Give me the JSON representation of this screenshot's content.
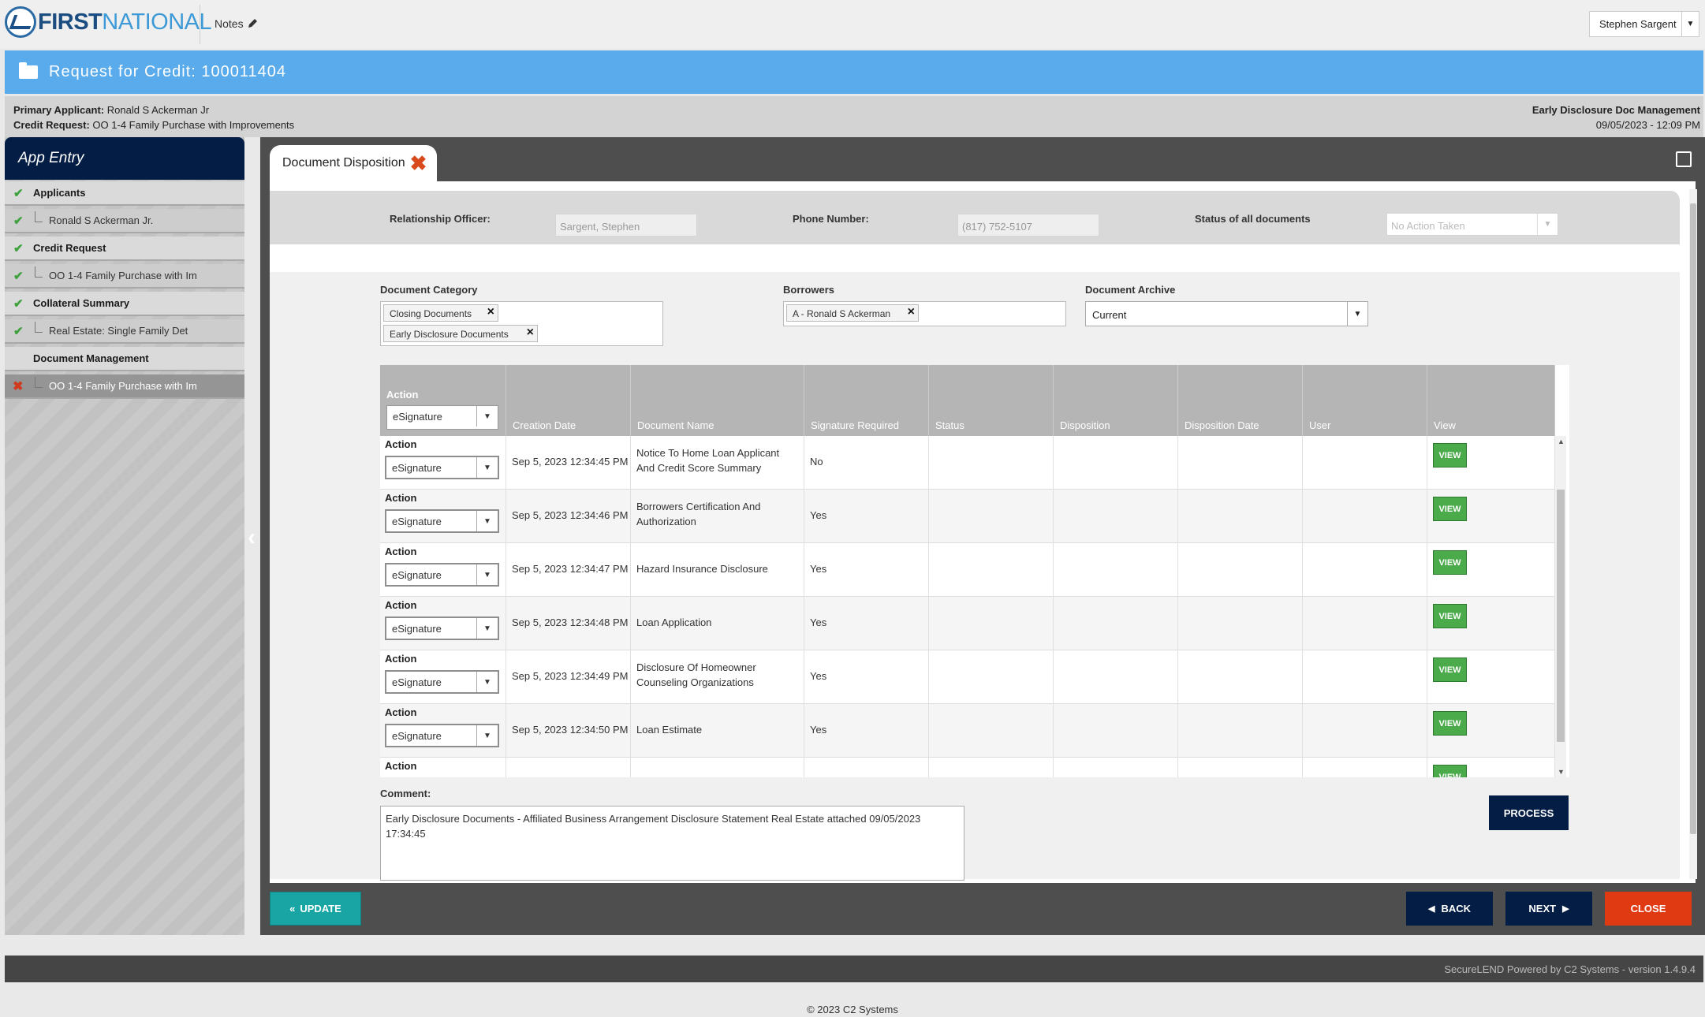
{
  "header": {
    "logo_first": "FIRST",
    "logo_second": "NATIONAL",
    "notes_label": "Notes",
    "user_name": "Stephen Sargent"
  },
  "title": "Request for Credit: 100011404",
  "info": {
    "primary_applicant_label": "Primary Applicant:",
    "primary_applicant": "Ronald S Ackerman Jr",
    "credit_request_label": "Credit Request:",
    "credit_request": "OO 1-4 Family Purchase with Improvements",
    "module": "Early Disclosure Doc Management",
    "datetime": "09/05/2023 - 12:09 PM"
  },
  "sidebar": {
    "title": "App Entry",
    "items": [
      {
        "label": "Applicants",
        "type": "header",
        "status": "done"
      },
      {
        "label": "Ronald S Ackerman Jr.",
        "type": "sub",
        "status": "done"
      },
      {
        "label": "Credit Request",
        "type": "header",
        "status": "done"
      },
      {
        "label": "OO 1-4 Family Purchase with Im",
        "type": "sub",
        "status": "done"
      },
      {
        "label": "Collateral Summary",
        "type": "header",
        "status": "done"
      },
      {
        "label": "Real Estate: Single Family Det",
        "type": "sub",
        "status": "done"
      },
      {
        "label": "Document Management",
        "type": "header",
        "status": "none"
      },
      {
        "label": "OO 1-4 Family Purchase with Im",
        "type": "sub",
        "status": "error",
        "active": true
      }
    ]
  },
  "tab": {
    "label": "Document Disposition"
  },
  "officer": {
    "relationship_officer_label": "Relationship Officer:",
    "relationship_officer": "Sargent, Stephen",
    "phone_label": "Phone Number:",
    "phone": "(817) 752-5107",
    "status_label": "Status of all documents",
    "status_value": "No Action Taken"
  },
  "filters": {
    "category_label": "Document Category",
    "categories": [
      "Closing Documents",
      "Early Disclosure Documents"
    ],
    "borrowers_label": "Borrowers",
    "borrowers": [
      "A - Ronald S Ackerman"
    ],
    "archive_label": "Document Archive",
    "archive_value": "Current"
  },
  "grid": {
    "header_action_label": "Action",
    "header_action_value": "eSignature",
    "columns": [
      "Creation Date",
      "Document Name",
      "Signature Required",
      "Status",
      "Disposition",
      "Disposition Date",
      "User",
      "View"
    ],
    "action_label": "Action",
    "view_label": "VIEW",
    "rows": [
      {
        "action": "eSignature",
        "created": "Sep 5, 2023 12:34:45 PM",
        "name_1": "Notice To Home Loan Applicant",
        "name_2": "And Credit Score Summary",
        "sig": "No"
      },
      {
        "action": "eSignature",
        "created": "Sep 5, 2023 12:34:46 PM",
        "name_1": "Borrowers Certification And",
        "name_2": "Authorization",
        "sig": "Yes"
      },
      {
        "action": "eSignature",
        "created": "Sep 5, 2023 12:34:47 PM",
        "name_1": "Hazard Insurance Disclosure",
        "name_2": "",
        "sig": "Yes"
      },
      {
        "action": "eSignature",
        "created": "Sep 5, 2023 12:34:48 PM",
        "name_1": "Loan Application",
        "name_2": "",
        "sig": "Yes"
      },
      {
        "action": "eSignature",
        "created": "Sep 5, 2023 12:34:49 PM",
        "name_1": "Disclosure Of Homeowner",
        "name_2": "Counseling Organizations",
        "sig": "Yes"
      },
      {
        "action": "eSignature",
        "created": "Sep 5, 2023 12:34:50 PM",
        "name_1": "Loan Estimate",
        "name_2": "",
        "sig": "Yes"
      }
    ]
  },
  "comment": {
    "label": "Comment:",
    "text": "Early Disclosure Documents - Affiliated Business Arrangement Disclosure Statement Real Estate attached 09/05/2023 17:34:45"
  },
  "buttons": {
    "process": "PROCESS",
    "update": "UPDATE",
    "back": "BACK",
    "next": "NEXT",
    "close": "CLOSE"
  },
  "footer": {
    "powered": "SecureLEND Powered by C2 Systems - version 1.4.9.4",
    "copyright": "© 2023 C2 Systems"
  },
  "colors": {
    "title_bar": "#5aabec",
    "navy": "#031d45",
    "view_green": "#4bab4b",
    "update_teal": "#1aa5a5",
    "close_red": "#e03a12"
  }
}
